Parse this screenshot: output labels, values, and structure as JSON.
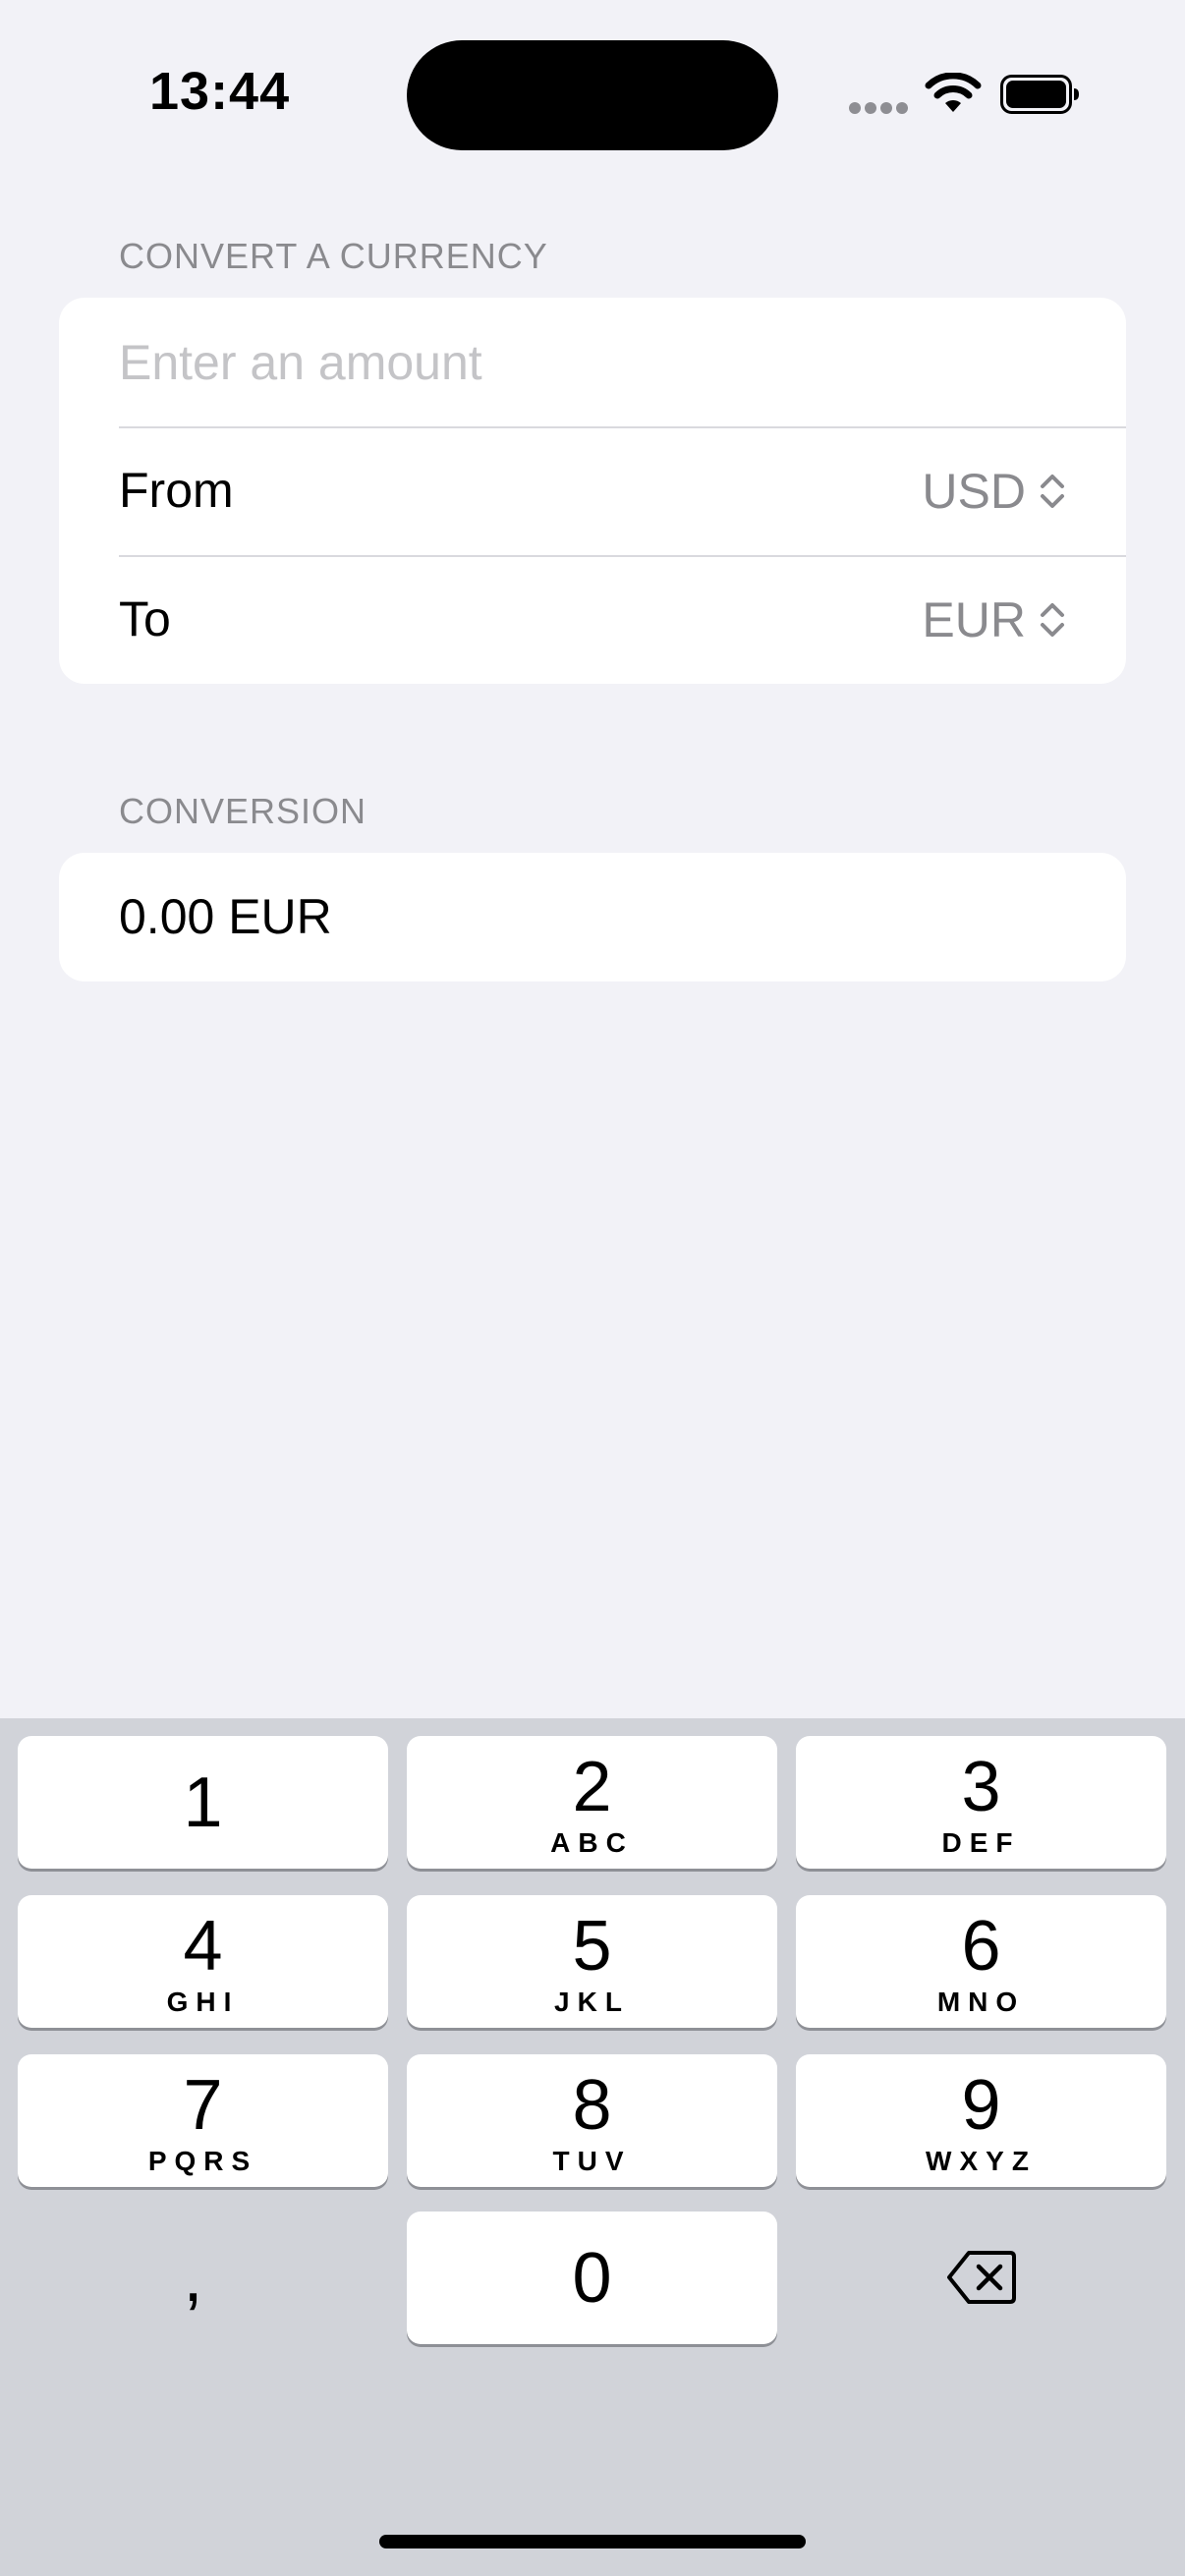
{
  "status_bar": {
    "time": "13:44"
  },
  "convert_section": {
    "header": "CONVERT A CURRENCY",
    "amount_placeholder": "Enter an amount",
    "amount_value": "",
    "from_label": "From",
    "from_value": "USD",
    "to_label": "To",
    "to_value": "EUR"
  },
  "conversion_section": {
    "header": "CONVERSION",
    "result": "0.00 EUR"
  },
  "keyboard": {
    "keys": [
      {
        "digit": "1",
        "letters": ""
      },
      {
        "digit": "2",
        "letters": "ABC"
      },
      {
        "digit": "3",
        "letters": "DEF"
      },
      {
        "digit": "4",
        "letters": "GHI"
      },
      {
        "digit": "5",
        "letters": "JKL"
      },
      {
        "digit": "6",
        "letters": "MNO"
      },
      {
        "digit": "7",
        "letters": "PQRS"
      },
      {
        "digit": "8",
        "letters": "TUV"
      },
      {
        "digit": "9",
        "letters": "WXYZ"
      },
      {
        "digit": "0",
        "letters": ""
      }
    ],
    "comma": ","
  },
  "icons": {
    "wifi": "wifi-icon",
    "battery": "battery-icon",
    "signal": "cellular-signal-icon",
    "chevron": "chevron-up-down-icon",
    "delete": "delete-backward-icon"
  }
}
